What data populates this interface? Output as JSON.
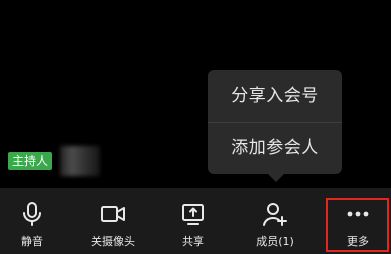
{
  "popup_menu": {
    "items": [
      {
        "label": "分享入会号"
      },
      {
        "label": "添加参会人"
      }
    ]
  },
  "host": {
    "tag_label": "主持人"
  },
  "toolbar": {
    "buttons": [
      {
        "label": "静音",
        "icon": "microphone-icon"
      },
      {
        "label": "关摄像头",
        "icon": "camera-icon"
      },
      {
        "label": "共享",
        "icon": "screen-share-icon"
      },
      {
        "label": "成员(1)",
        "icon": "add-member-icon"
      },
      {
        "label": "更多",
        "icon": "more-dots-icon"
      }
    ]
  },
  "colors": {
    "background": "#000000",
    "toolbar_bg": "#1b1b1b",
    "popup_bg": "#2b2b2b",
    "host_tag": "#3aa84b",
    "highlight": "#e3261f",
    "text": "#e8e8e8"
  }
}
